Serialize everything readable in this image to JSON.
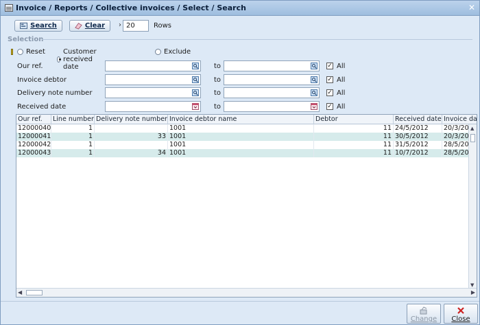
{
  "window": {
    "title": "Invoice / Reports / Collective invoices / Select / Search",
    "close_glyph": "✕"
  },
  "toolbar": {
    "search_label": "Search",
    "clear_label": "Clear",
    "rows_arrow": "›",
    "rows_value": "20",
    "rows_label": "Rows"
  },
  "selection": {
    "header": "Selection",
    "radios": {
      "reset": "Reset",
      "customer_received_date": "Customer received date",
      "exclude": "Exclude",
      "selected": "customer_received_date"
    },
    "filters": [
      {
        "label": "Our ref.",
        "to": "to",
        "all_label": "All",
        "all_checked": true,
        "icon": "lookup-icon"
      },
      {
        "label": "Invoice debtor",
        "to": "to",
        "all_label": "All",
        "all_checked": true,
        "icon": "lookup-icon"
      },
      {
        "label": "Delivery note number",
        "to": "to",
        "all_label": "All",
        "all_checked": true,
        "icon": "lookup-icon"
      },
      {
        "label": "Received date",
        "to": "to",
        "all_label": "All",
        "all_checked": true,
        "icon": "calendar-icon"
      }
    ],
    "check_glyph": "✓"
  },
  "grid": {
    "columns": [
      "Our ref.",
      "Line number",
      "Delivery note number",
      "Invoice debtor name",
      "Debtor",
      "Received date",
      "Invoice da"
    ],
    "rows": [
      [
        "12000040",
        "1",
        "",
        "1001",
        "11",
        "24/5/2012",
        "20/3/20"
      ],
      [
        "12000041",
        "1",
        "33",
        "1001",
        "11",
        "30/5/2012",
        "20/3/20"
      ],
      [
        "12000042",
        "1",
        "",
        "1001",
        "11",
        "31/5/2012",
        "28/5/20"
      ],
      [
        "12000043",
        "1",
        "34",
        "1001",
        "11",
        "10/7/2012",
        "28/5/20"
      ]
    ]
  },
  "footer": {
    "change_label": "Change",
    "close_label": "Close"
  },
  "colors": {
    "window_bg": "#dde9f6",
    "titlebar": "#9ebedf",
    "alt_row": "#d6ebeb",
    "close_icon": "#cc2222"
  }
}
